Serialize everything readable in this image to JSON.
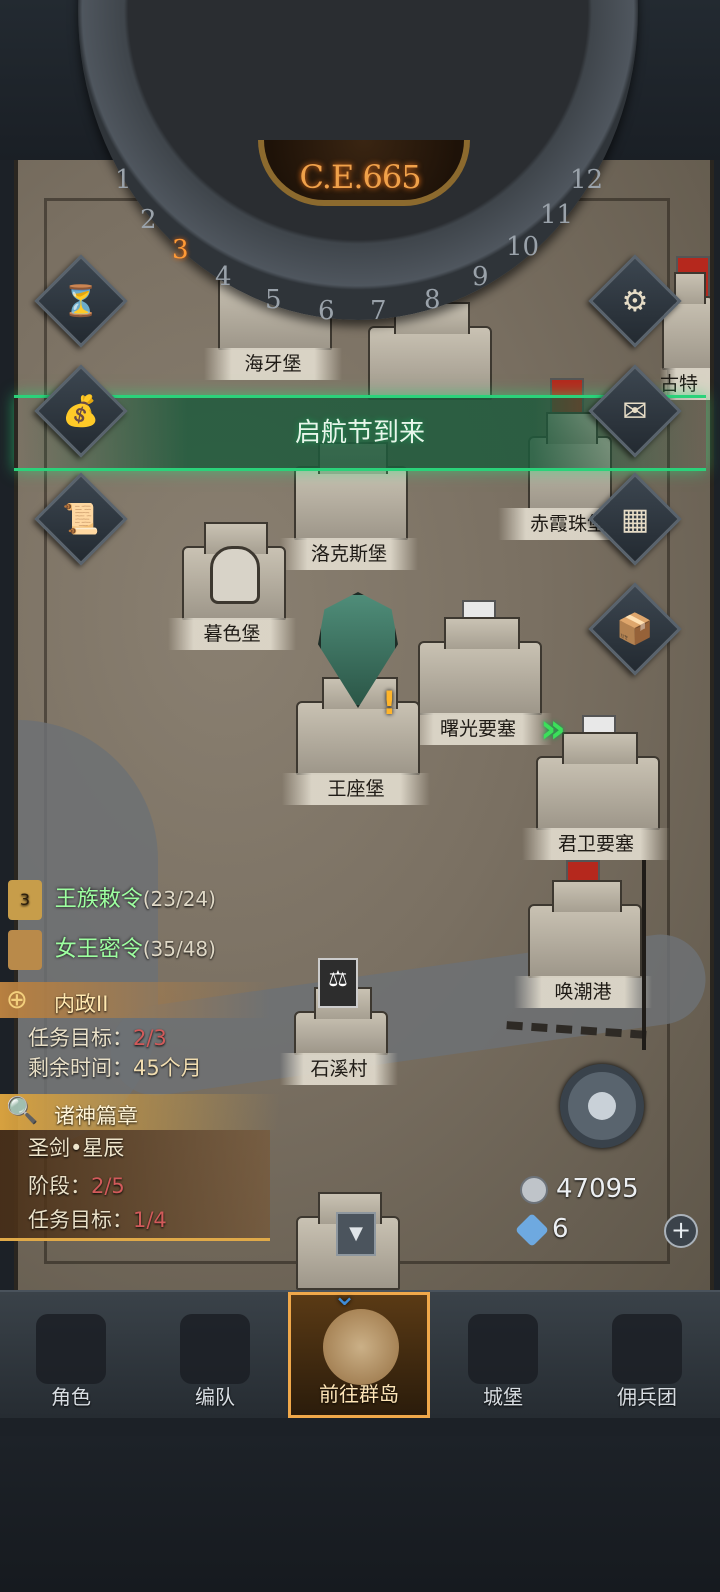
{
  "calendar": {
    "year": "C.E.665",
    "months": [
      "1",
      "2",
      "3",
      "4",
      "5",
      "6",
      "7",
      "8",
      "9",
      "10",
      "11",
      "12"
    ],
    "current_month": "3"
  },
  "event_banner": "启航节到来",
  "locations": [
    {
      "name": "海牙堡"
    },
    {
      "name": "洛克斯堡"
    },
    {
      "name": "赤霞珠堡"
    },
    {
      "name": "暮色堡"
    },
    {
      "name": "曙光要塞"
    },
    {
      "name": "王座堡"
    },
    {
      "name": "君卫要塞"
    },
    {
      "name": "唤潮港"
    },
    {
      "name": "石溪村"
    },
    {
      "name": "古特"
    }
  ],
  "side_menu": {
    "left": [
      "hourglass-icon",
      "money-bag-icon",
      "scroll-icon"
    ],
    "right": [
      "gear-icon",
      "mail-icon",
      "layout-icon",
      "supplies-icon"
    ]
  },
  "orders": [
    {
      "badge": "3",
      "name": "王族敕令",
      "progress": "(23/24)"
    },
    {
      "name": "女王密令",
      "progress": "(35/48)"
    }
  ],
  "quest_domestic": {
    "title": "内政II",
    "goal_label": "任务目标：",
    "goal_value": "2/3",
    "time_label": "剩余时间：",
    "time_value": "45个月"
  },
  "quest_gods": {
    "title": "诸神篇章",
    "subtitle": "圣剑•星辰",
    "stage_label": "阶段：",
    "stage_value": "2/5",
    "goal_label": "任务目标：",
    "goal_value": "1/4"
  },
  "resources": {
    "silver": "47095",
    "crystal": "6"
  },
  "nav": [
    {
      "label": "角色"
    },
    {
      "label": "编队"
    },
    {
      "label": "前往群岛",
      "active": true
    },
    {
      "label": "城堡"
    },
    {
      "label": "佣兵团"
    }
  ],
  "colors": {
    "accent": "#f0a84a",
    "banner_green": "#2bd27a",
    "year_orange": "#f0a14a"
  }
}
